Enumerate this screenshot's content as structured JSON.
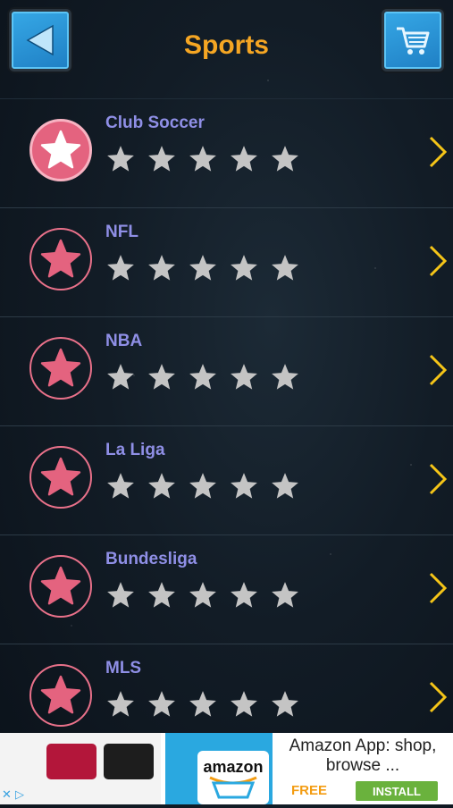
{
  "header": {
    "title": "Sports",
    "back_icon": "back-arrow-icon",
    "cart_icon": "cart-icon"
  },
  "colors": {
    "accent": "#f5a623",
    "badge": "#e4637f",
    "chevron": "#f5c518",
    "star_empty": "#c4c4c4",
    "label": "#8f8fe6"
  },
  "list": {
    "items": [
      {
        "label": "Club Soccer",
        "selected": true,
        "rating": 0,
        "max_rating": 5
      },
      {
        "label": "NFL",
        "selected": false,
        "rating": 0,
        "max_rating": 5
      },
      {
        "label": "NBA",
        "selected": false,
        "rating": 0,
        "max_rating": 5
      },
      {
        "label": "La Liga",
        "selected": false,
        "rating": 0,
        "max_rating": 5
      },
      {
        "label": "Bundesliga",
        "selected": false,
        "rating": 0,
        "max_rating": 5
      },
      {
        "label": "MLS",
        "selected": false,
        "rating": 0,
        "max_rating": 5
      }
    ]
  },
  "ad": {
    "brand": "amazon",
    "headline": "Amazon App: shop, browse ...",
    "price_tag": "FREE",
    "cta": "INSTALL"
  }
}
